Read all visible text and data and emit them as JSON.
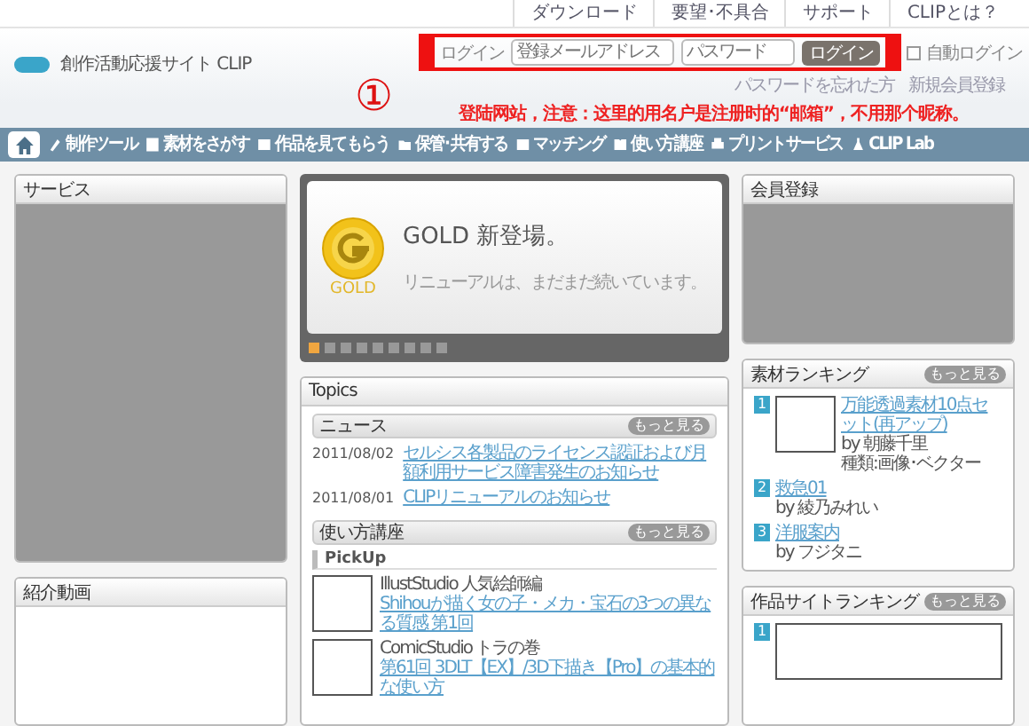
{
  "top_links": [
    "ダウンロード",
    "要望･不具合",
    "サポート",
    "CLIPとは？"
  ],
  "header": {
    "site_title": "創作活動応援サイト CLIP",
    "login": {
      "label": "ログイン",
      "email_placeholder": "登録メールアドレス",
      "password_placeholder": "パスワード",
      "button": "ログイン",
      "auto_login": {
        "label": "自動ログイン",
        "checked": false
      }
    },
    "links": [
      "パスワードを忘れた方",
      "新規会員登録"
    ]
  },
  "nav": [
    {
      "kind": "home",
      "selected": true
    },
    {
      "kind": "link",
      "label": "制作ツール",
      "selected": false
    },
    {
      "kind": "link",
      "label": "素材をさがす",
      "selected": false
    },
    {
      "kind": "link",
      "label": "作品を見てもらう",
      "selected": false
    },
    {
      "kind": "link",
      "label": "保管･共有する",
      "selected": false
    },
    {
      "kind": "link",
      "label": "マッチング",
      "selected": false
    },
    {
      "kind": "link",
      "label": "使い方講座",
      "selected": false
    },
    {
      "kind": "link",
      "label": "プリントサービス",
      "selected": false
    },
    {
      "kind": "link",
      "label": "CLIP Lab",
      "selected": false
    }
  ],
  "annotation": {
    "marker": "①",
    "note": "登陆网站，注意：这里的用名户是注册时的“邮箱”，不用那个昵称。"
  },
  "left": {
    "service_title": "サービス",
    "video_title": "紹介動画"
  },
  "slider": {
    "badge": "GOLD",
    "headline": "GOLD 新登場。",
    "subline": "リニューアルは、まだまだ続いています。",
    "dots": [
      {
        "selected": true
      },
      {
        "selected": false
      },
      {
        "selected": false
      },
      {
        "selected": false
      },
      {
        "selected": false
      },
      {
        "selected": false
      },
      {
        "selected": false
      },
      {
        "selected": false
      },
      {
        "selected": false
      }
    ]
  },
  "topics": {
    "title": "Topics",
    "news": {
      "title": "ニュース",
      "more": "もっと見る",
      "items": [
        {
          "date": "2011/08/02",
          "text": "セルシス各製品のライセンス認証および月額利用サービス障害発生のお知らせ"
        },
        {
          "date": "2011/08/01",
          "text": "CLIPリニューアルのお知らせ"
        }
      ]
    },
    "lessons": {
      "title": "使い方講座",
      "more": "もっと見る",
      "pickup": "PickUp",
      "items": [
        {
          "series": "IllustStudio 人気絵師編",
          "link": "Shihouが描く女の子・メカ・宝石の3つの異なる質感 第1回"
        },
        {
          "series": "ComicStudio トラの巻",
          "link": "第61回 3DLT【EX】/3D下描き【Pro】の基本的な使い方"
        }
      ]
    }
  },
  "right": {
    "member_title": "会員登録",
    "material_ranking": {
      "title": "素材ランキング",
      "more": "もっと見る",
      "items": [
        {
          "rank": "1",
          "kind": "thumb",
          "title": "万能透過素材10点セット(再アップ)",
          "by": "by 朝藤千里",
          "type": "種類:画像･ベクター"
        },
        {
          "rank": "2",
          "kind": "plain",
          "title": "救急01",
          "by": "by 綾乃みれい"
        },
        {
          "rank": "3",
          "kind": "plain",
          "title": "洋服案内",
          "by": "by フジタニ"
        }
      ]
    },
    "site_ranking": {
      "title": "作品サイトランキング",
      "more": "もっと見る",
      "items": [
        {
          "rank": "1",
          "kind": "wide"
        }
      ]
    }
  }
}
